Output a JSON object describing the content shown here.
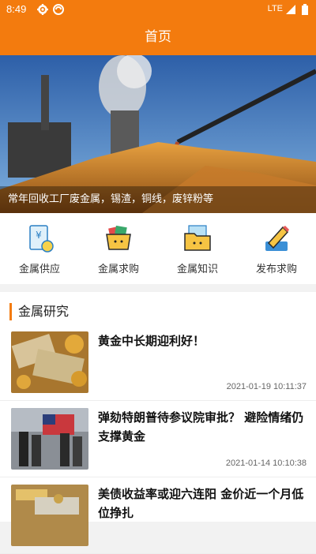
{
  "status_bar": {
    "time": "8:49",
    "network": "LTE"
  },
  "app_bar": {
    "title": "首页"
  },
  "banner": {
    "caption": "常年回收工厂废金属，锡渣，铜线，废锌粉等"
  },
  "menu": [
    {
      "label": "金属供应",
      "icon": "document-yen-icon"
    },
    {
      "label": "金属求购",
      "icon": "basket-icon"
    },
    {
      "label": "金属知识",
      "icon": "folder-icon"
    },
    {
      "label": "发布求购",
      "icon": "pencil-icon"
    }
  ],
  "section": {
    "title": "金属研究"
  },
  "news": [
    {
      "title": "黄金中长期迎利好！",
      "date": "2021-01-19 10:11:37"
    },
    {
      "title": "弹劾特朗普待参议院审批？ 避险情绪仍支撑黄金",
      "date": "2021-01-14 10:10:38"
    },
    {
      "title": "美债收益率或迎六连阳 金价近一个月低位挣扎",
      "date": ""
    }
  ],
  "colors": {
    "accent": "#f37b0e"
  }
}
